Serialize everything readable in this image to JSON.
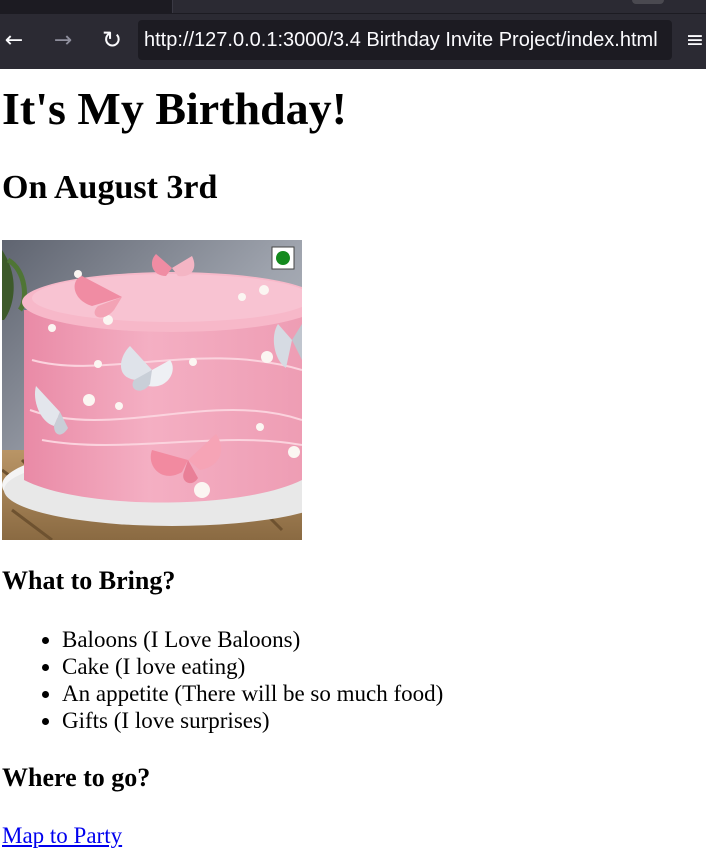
{
  "browser": {
    "url": "http://127.0.0.1:3000/3.4 Birthday Invite Project/index.html",
    "back_icon": "arrow-left-icon",
    "forward_icon": "arrow-right-icon",
    "reload_icon": "reload-icon",
    "menu_icon": "hamburger-menu-icon"
  },
  "page": {
    "title": "It's My Birthday!",
    "date_heading": "On August 3rd",
    "image_alt": "pink butterfly cake",
    "bring_heading": "What to Bring?",
    "bring_items": [
      "Baloons (I Love Baloons)",
      "Cake (I love eating)",
      "An appetite (There will be so much food)",
      "Gifts (I love surprises)"
    ],
    "where_heading": "Where to go?",
    "map_link": "Map to Party"
  },
  "colors": {
    "toolbar_bg": "#2b2a33",
    "urlbar_bg": "#1c1b22",
    "link": "#0000ee",
    "cake_pink": "#f2a9bd"
  }
}
